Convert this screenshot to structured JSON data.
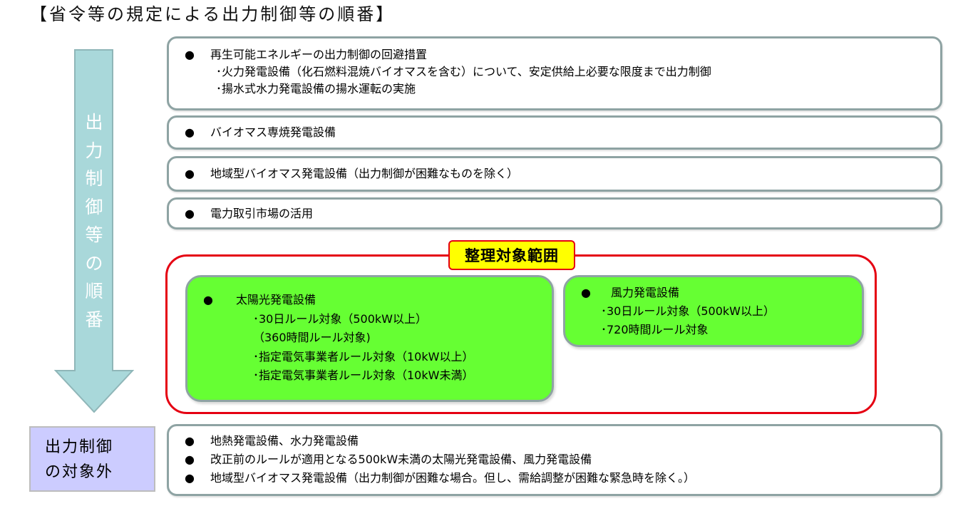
{
  "title": "【省令等の規定による出力制御等の順番】",
  "arrow_label": [
    "出",
    "力",
    "制",
    "御",
    "等",
    "の",
    "順",
    "番"
  ],
  "boxes": [
    {
      "bullet": "再生可能エネルギーの出力制御の回避措置",
      "subs": [
        "･火力発電設備（化石燃料混焼バイオマスを含む）について、安定供給上必要な限度まで出力制御",
        "･揚水式水力発電設備の揚水運転の実施"
      ]
    },
    {
      "bullet": "バイオマス専焼発電設備",
      "subs": []
    },
    {
      "bullet": "地域型バイオマス発電設備（出力制御が困難なものを除く）",
      "subs": []
    },
    {
      "bullet": "電力取引市場の活用",
      "subs": []
    }
  ],
  "scope_tag": "整理対象範囲",
  "solar": {
    "bullet": "太陽光発電設備",
    "subs": [
      "･30日ルール対象（500kW以上）",
      "（360時間ルール対象)",
      "･指定電気事業者ルール対象（10kW以上）",
      "･指定電気事業者ルール対象（10kW未満）"
    ]
  },
  "wind": {
    "bullet": "風力発電設備",
    "subs": [
      "･30日ルール対象（500kW以上）",
      "･720時間ルール対象"
    ]
  },
  "outside": {
    "label_lines": [
      "出力制御",
      "の対象外"
    ],
    "bullets": [
      "地熱発電設備、水力発電設備",
      "改正前のルールが適用となる500kW未満の太陽光発電設備、風力発電設備",
      "地域型バイオマス発電設備（出力制御が困難な場合。但し、需給調整が困難な緊急時を除く。）"
    ]
  },
  "bullet_symbol": "●",
  "colors": {
    "arrow": "#a9d8da",
    "box_border": "#8ea3a3",
    "scope_border": "#e50012",
    "scope_tag": "#ffff00",
    "green": "#66ff33",
    "outside_label": "#ccccff"
  }
}
